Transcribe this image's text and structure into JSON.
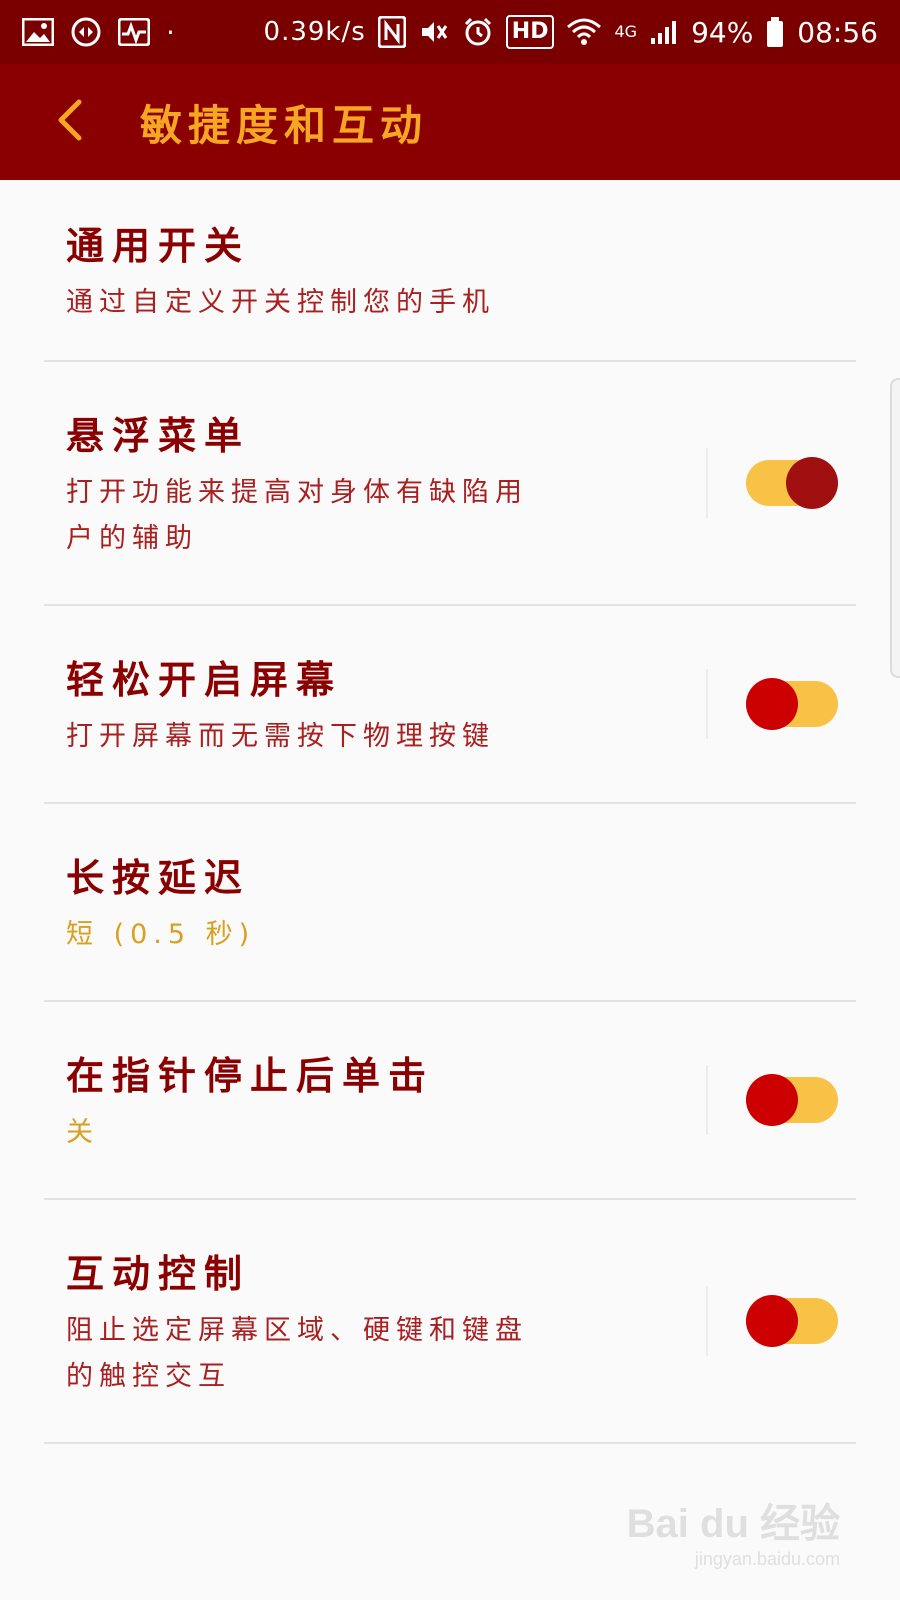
{
  "status_bar": {
    "speed": "0.39k/s",
    "network": "4G",
    "battery": "94%",
    "time": "08:56",
    "hd": "HD",
    "icons": [
      "image-icon",
      "sync-icon",
      "activity-icon",
      "nfc-icon",
      "mute-icon",
      "alarm-icon",
      "wifi-icon",
      "signal-icon",
      "battery-icon"
    ]
  },
  "app_bar": {
    "title": "敏捷度和互动",
    "back_icon": "chevron-left-icon"
  },
  "settings": [
    {
      "title": "通用开关",
      "subtitle": "通过自定义开关控制您的手机",
      "has_toggle": false
    },
    {
      "title": "悬浮菜单",
      "subtitle": "打开功能来提高对身体有缺陷用户的辅助",
      "has_toggle": true,
      "toggle_state": "on"
    },
    {
      "title": "轻松开启屏幕",
      "subtitle": "打开屏幕而无需按下物理按键",
      "has_toggle": true,
      "toggle_state": "off"
    },
    {
      "title": "长按延迟",
      "subtitle": "短 (0.5 秒)",
      "has_toggle": false
    },
    {
      "title": "在指针停止后单击",
      "subtitle": "关",
      "has_toggle": true,
      "toggle_state": "off"
    },
    {
      "title": "互动控制",
      "subtitle": "阻止选定屏幕区域、硬键和键盘的触控交互",
      "has_toggle": true,
      "toggle_state": "off"
    }
  ],
  "colors": {
    "status_bar_bg": "#7a0000",
    "app_bar_bg": "#8a0000",
    "title_text": "#f5a623",
    "item_title": "#8a0000",
    "item_subtitle": "#a82020",
    "value_gold": "#d8a020",
    "toggle_track": "#f8c246",
    "toggle_knob": "#c80000"
  },
  "watermark": {
    "logo": "Bai du 经验",
    "url": "jingyan.baidu.com"
  }
}
